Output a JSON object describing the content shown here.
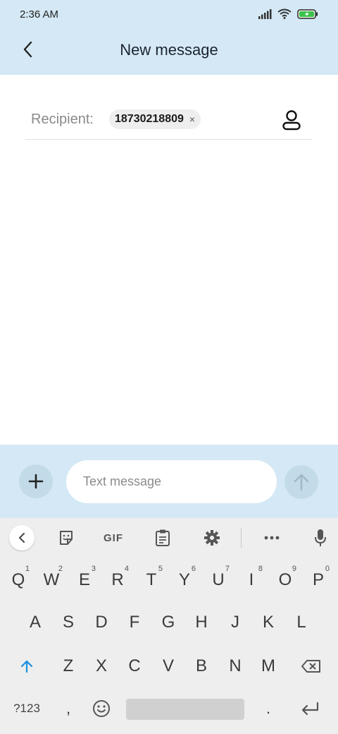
{
  "status": {
    "time": "2:36 AM"
  },
  "header": {
    "title": "New message"
  },
  "recipient": {
    "label": "Recipient:",
    "chip_number": "18730218809",
    "chip_remove": "×"
  },
  "compose": {
    "placeholder": "Text message"
  },
  "keyboard": {
    "toolbar": {
      "gif": "GIF"
    },
    "row1": [
      {
        "k": "Q",
        "h": "1"
      },
      {
        "k": "W",
        "h": "2"
      },
      {
        "k": "E",
        "h": "3"
      },
      {
        "k": "R",
        "h": "4"
      },
      {
        "k": "T",
        "h": "5"
      },
      {
        "k": "Y",
        "h": "6"
      },
      {
        "k": "U",
        "h": "7"
      },
      {
        "k": "I",
        "h": "8"
      },
      {
        "k": "O",
        "h": "9"
      },
      {
        "k": "P",
        "h": "0"
      }
    ],
    "row2": [
      "A",
      "S",
      "D",
      "F",
      "G",
      "H",
      "J",
      "K",
      "L"
    ],
    "row3": [
      "Z",
      "X",
      "C",
      "V",
      "B",
      "N",
      "M"
    ],
    "row4": {
      "symbols": "?123",
      "comma": ",",
      "period": "."
    }
  },
  "colors": {
    "accent": "#1a8fe0",
    "panel": "#d4e9f5"
  }
}
